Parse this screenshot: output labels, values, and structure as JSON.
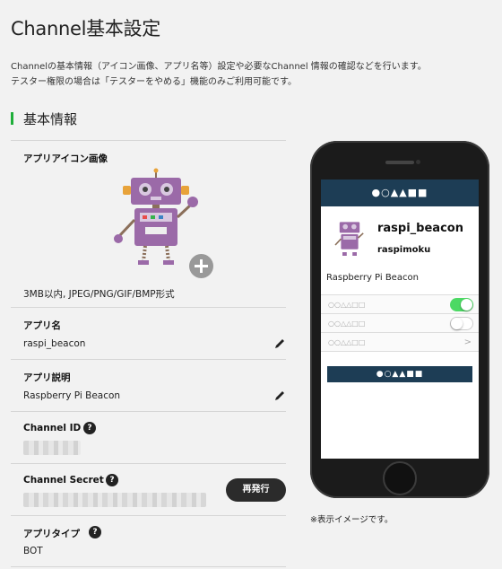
{
  "page": {
    "title": "Channel基本設定",
    "description_line1": "Channelの基本情報（アイコン画像、アプリ名等）設定や必要なChannel 情報の確認などを行います。",
    "description_line2": "テスター権限の場合は「テスターをやめる」機能のみご利用可能です。"
  },
  "section": {
    "title": "基本情報",
    "accent_color": "#1fae3a"
  },
  "form": {
    "icon": {
      "label": "アプリアイコン画像",
      "note": "3MB以内, JPEG/PNG/GIF/BMP形式",
      "add_icon": "plus-icon"
    },
    "app_name": {
      "label": "アプリ名",
      "value": "raspi_beacon",
      "edit_icon": "pencil-icon"
    },
    "app_desc": {
      "label": "アプリ説明",
      "value": "Raspberry Pi Beacon",
      "edit_icon": "pencil-icon"
    },
    "channel_id": {
      "label": "Channel ID",
      "help": "?"
    },
    "channel_secret": {
      "label": "Channel Secret",
      "help": "?",
      "button": "再発行"
    },
    "app_type": {
      "label": "アプリタイプ",
      "help": "?",
      "value": "BOT"
    }
  },
  "preview": {
    "header": "●○▲▲■■",
    "name": "raspi_beacon",
    "sub": "raspimoku",
    "desc": "Raspberry Pi Beacon",
    "items": [
      {
        "label": "○○△△□□",
        "control": "toggle-on"
      },
      {
        "label": "○○△△□□",
        "control": "toggle-off"
      },
      {
        "label": "○○△△□□",
        "control": "chevron"
      }
    ],
    "button": "●○▲▲■■",
    "header_color": "#1d3d55",
    "caption": "※表示イメージです。"
  }
}
